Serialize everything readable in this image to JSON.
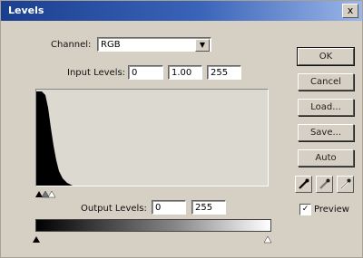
{
  "window": {
    "title": "Levels",
    "close_glyph": "x"
  },
  "channel": {
    "label": "Channel:",
    "value": "RGB"
  },
  "input_levels": {
    "label": "Input Levels:",
    "black": "0",
    "gamma": "1.00",
    "white": "255"
  },
  "histogram": {
    "peak_region": "shadows",
    "values": []
  },
  "output_levels": {
    "label": "Output Levels:",
    "black": "0",
    "white": "255"
  },
  "buttons": {
    "ok": "OK",
    "cancel": "Cancel",
    "load": "Load...",
    "save": "Save...",
    "auto": "Auto"
  },
  "eyedroppers": [
    "black-point-eyedropper-icon",
    "gray-point-eyedropper-icon",
    "white-point-eyedropper-icon"
  ],
  "preview": {
    "label": "Preview",
    "checked": true,
    "check_glyph": "✓"
  },
  "colors": {
    "titlebar_start": "#1b3f8f",
    "titlebar_end": "#9bb6e8",
    "dialog_bg": "#d6cfc3"
  }
}
